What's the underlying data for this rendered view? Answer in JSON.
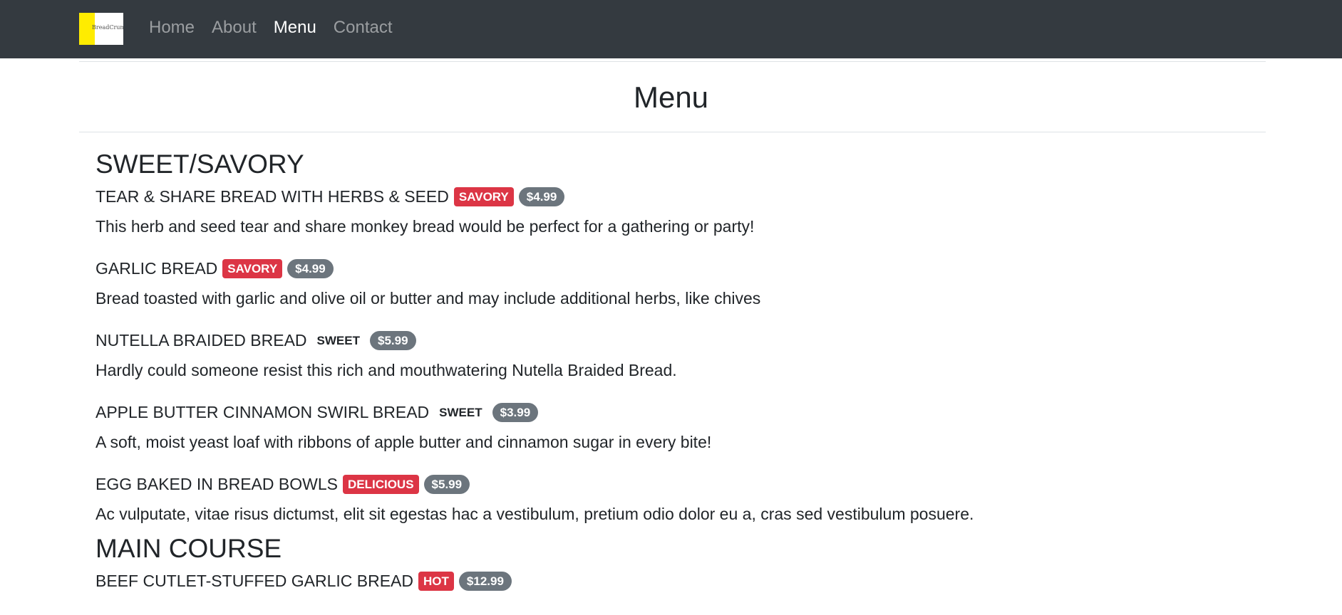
{
  "nav": {
    "brand_text": "BreadCrumbs",
    "links": [
      {
        "label": "Home"
      },
      {
        "label": "About"
      },
      {
        "label": "Menu"
      },
      {
        "label": "Contact"
      }
    ]
  },
  "page": {
    "title": "Menu"
  },
  "sections": [
    {
      "title": "SWEET/SAVORY",
      "items": [
        {
          "name": "TEAR & SHARE BREAD WITH HERBS & SEED",
          "tag": "SAVORY",
          "price": "$4.99",
          "desc": "This herb and seed tear and share monkey bread would be perfect for a gathering or party!"
        },
        {
          "name": "GARLIC BREAD",
          "tag": "SAVORY",
          "price": "$4.99",
          "desc": "Bread toasted with garlic and olive oil or butter and may include additional herbs, like chives"
        },
        {
          "name": "NUTELLA BRAIDED BREAD",
          "tag": "SWEET",
          "price": "$5.99",
          "desc": "Hardly could someone resist this rich and mouthwatering Nutella Braided Bread."
        },
        {
          "name": "APPLE BUTTER CINNAMON SWIRL BREAD",
          "tag": "SWEET",
          "price": "$3.99",
          "desc": "A soft, moist yeast loaf with ribbons of apple butter and cinnamon sugar in every bite!"
        },
        {
          "name": "EGG BAKED IN BREAD BOWLS",
          "tag": "DELICIOUS",
          "price": "$5.99",
          "desc": "Ac vulputate, vitae risus dictumst, elit sit egestas hac a vestibulum, pretium odio dolor eu a, cras sed vestibulum posuere."
        }
      ]
    },
    {
      "title": "MAIN COURSE",
      "items": [
        {
          "name": "BEEF CUTLET-STUFFED GARLIC BREAD",
          "tag": "HOT",
          "price": "$12.99"
        }
      ]
    }
  ],
  "colors": {
    "navbar": "#343a40",
    "danger": "#dc3545",
    "price_badge": "#6c757d",
    "brand_yellow": "#ffec00"
  }
}
